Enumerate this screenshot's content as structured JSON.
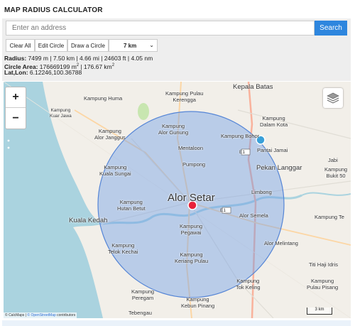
{
  "header": {
    "title": "MAP RADIUS CALCULATOR"
  },
  "search": {
    "placeholder": "Enter an address",
    "button_label": "Search"
  },
  "toolbar": {
    "clear_all": "Clear All",
    "edit_circle": "Edit Circle",
    "draw_circle": "Draw a Circle",
    "radius_select": "7 km"
  },
  "results": {
    "radius_label": "Radius:",
    "radius_value": "7499 m | 7.50 km | 4.66 mi | 24603 ft | 4.05 nm",
    "area_label": "Circle Area:",
    "area_value_km": "176669199 m",
    "area_value_sep": " | 176.67 km",
    "area_exp": "2",
    "latlon_label": "Lat,Lon:",
    "latlon_value": "6.12246,100.36788"
  },
  "map": {
    "zoom_in": "+",
    "zoom_out": "−",
    "scale": "3 km",
    "attribution_a": "© CalcMaps | ",
    "attribution_link": "© OpenStreetMap",
    "attribution_b": " contributors",
    "circle_color": "#6b9ce8",
    "center_marker_color": "#e8213a",
    "place_marker_color": "#3aa0d8",
    "labels": {
      "kepala_batas": "Kepala Batas",
      "kampung_huma": "Kampung Huma",
      "kampung_pulau_kerengga": "Kampung Pulau\nKerengga",
      "kampung_kuar_jawa": "Kampung\nKuar Jawa",
      "kampung_alor_gunung": "Kampung\nAlor Gunung",
      "kampung_dalam_kota": "Kampung\nDalam Kota",
      "kampung_alor_janggus": "Kampung\nAlor Janggus",
      "kampung_bohor": "Kampung Bohor",
      "mentaloon": "Mentaloon",
      "pantai_jamai": "Pantai Jamai",
      "jabi": "Jabi",
      "kampung_bukit_50": "Kampung\nBukit 50",
      "pumpong": "Pumpong",
      "pekan_langgar": "Pekan Langgar",
      "kampung_kuala_sungai": "Kampung\nKuala Sungai",
      "limbong": "Limbong",
      "alor_setar": "Alor Setar",
      "kampung_hutan_betut": "Kampung\nHutan Betut",
      "kuala_kedah": "Kuala Kedah",
      "alor_semela": "Alor Semela",
      "kampung_te": "Kampung Te",
      "kampung_pegawai": "Kampung\nPegawai",
      "kampung_telok_kechai": "Kampung\nTelok Kechai",
      "alor_melintang": "Alor Melintang",
      "kampung_keriang_pulau": "Kampung\nKeriang Pulau",
      "titi_haji_idris": "Titi Haji Idris",
      "kampung_pulau_pisang": "Kampung\nPulau Pisang",
      "kampung_tok_keling": "Kampung\nTok Keling",
      "kampung_peregam": "Kampung\nPeregam",
      "kampung_kebun_pinang": "Kampung\nKebun Pinang",
      "tebengau": "Tebengau",
      "road_e1_a": "E1",
      "road_e1_b": "E1"
    }
  }
}
